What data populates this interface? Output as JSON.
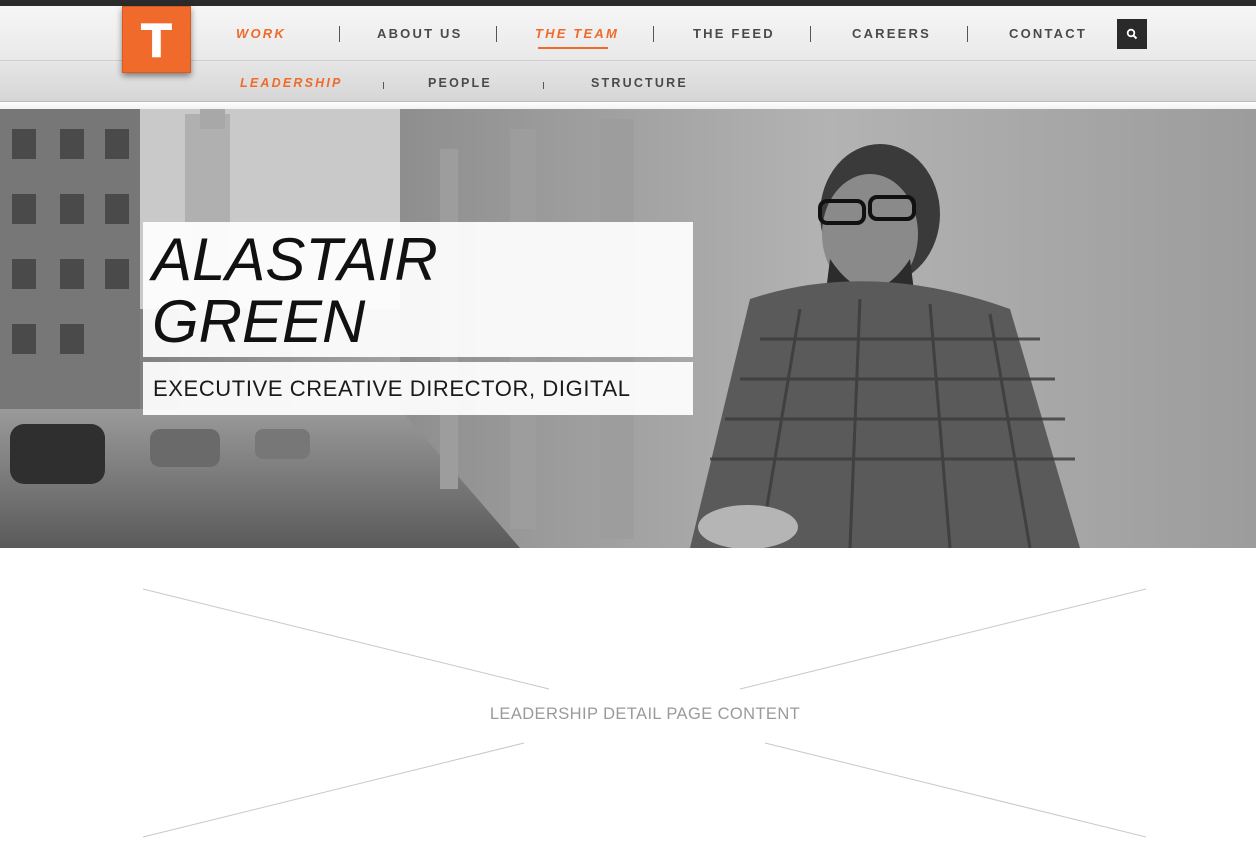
{
  "logo": {
    "letter": "T"
  },
  "nav": {
    "items": [
      {
        "label": "WORK"
      },
      {
        "label": "ABOUT US"
      },
      {
        "label": "THE TEAM"
      },
      {
        "label": "THE FEED"
      },
      {
        "label": "CAREERS"
      },
      {
        "label": "CONTACT"
      }
    ],
    "active": "THE TEAM",
    "search_icon": "search-icon"
  },
  "subnav": {
    "items": [
      {
        "label": "LEADERSHIP"
      },
      {
        "label": "PEOPLE"
      },
      {
        "label": "STRUCTURE"
      }
    ],
    "active": "LEADERSHIP"
  },
  "hero": {
    "name_line1": "ALASTAIR",
    "name_line2": "GREEN",
    "title": "EXECUTIVE CREATIVE DIRECTOR, DIGITAL"
  },
  "content": {
    "placeholder": "LEADERSHIP DETAIL PAGE CONTENT"
  },
  "colors": {
    "accent": "#ef6a2b",
    "dark": "#2a2a2a",
    "text": "#4a4a4a",
    "muted": "#9a9a9a"
  }
}
